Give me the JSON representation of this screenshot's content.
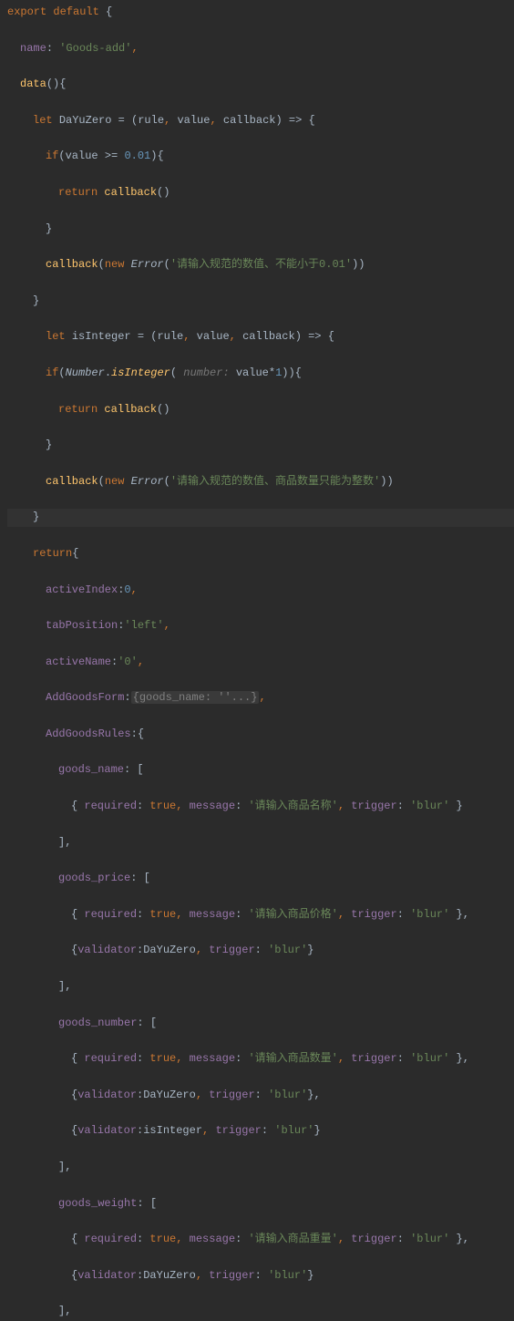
{
  "code": {
    "l1_export": "export",
    "l1_default": "default",
    "l1_brace": " {",
    "l2_name_key": "name",
    "l2_name_val": "'Goods-add'",
    "l3_data": "data",
    "l3_paren": "(){",
    "l4_let": "let",
    "l4_var": "DaYuZero",
    "l4_eq": " = (",
    "l4_rule": "rule",
    "l4_value": "value",
    "l4_callback": "callback",
    "l4_arrow": ") => {",
    "l5_if": "if",
    "l5_cond_open": "(",
    "l5_value": "value",
    "l5_gte": " >= ",
    "l5_num": "0.01",
    "l5_cond_close": "){",
    "l6_return": "return",
    "l6_callback": "callback",
    "l6_paren": "()",
    "l7_close": "}",
    "l8_callback": "callback",
    "l8_open": "(",
    "l8_new": "new",
    "l8_error": "Error",
    "l8_open2": "(",
    "l8_str": "'请输入规范的数值、不能小于0.01'",
    "l8_close": "))",
    "l9_close": "}",
    "l10_let": "let",
    "l10_var": "isInteger",
    "l10_eq": " = (",
    "l10_rule": "rule",
    "l10_value": "value",
    "l10_callback": "callback",
    "l10_arrow": ") => {",
    "l11_if": "if",
    "l11_open": "(",
    "l11_number": "Number",
    "l11_dot": ".",
    "l11_isint": "isInteger",
    "l11_open2": "(",
    "l11_hint": " number: ",
    "l11_value": "value",
    "l11_times": "*",
    "l11_one": "1",
    "l11_close": ")){",
    "l12_return": "return",
    "l12_callback": "callback",
    "l12_paren": "()",
    "l13_close": "}",
    "l14_callback": "callback",
    "l14_open": "(",
    "l14_new": "new",
    "l14_error": "Error",
    "l14_open2": "(",
    "l14_str": "'请输入规范的数值、商品数量只能为整数'",
    "l14_close": "))",
    "l15_close": "}",
    "l16_return": "return",
    "l16_brace": "{",
    "l17_key": "activeIndex",
    "l17_val": "0",
    "l18_key": "tabPosition",
    "l18_val": "'left'",
    "l19_key": "activeName",
    "l19_val": "'0'",
    "l20_key": "AddGoodsForm",
    "l20_folded": "{goods_name: ''...}",
    "l21_key": "AddGoodsRules",
    "l21_brace": ":{",
    "l22_key": "goods_name",
    "l22_open": ": [",
    "l23_open": "{ ",
    "l23_req": "required",
    "l23_true": "true",
    "l23_msg": "message",
    "l23_msgval": "'请输入商品名称'",
    "l23_trig": "trigger",
    "l23_trigval": "'blur'",
    "l23_close": " }",
    "l24_close": "],",
    "l25_key": "goods_price",
    "l25_open": ": [",
    "l26_open": "{ ",
    "l26_req": "required",
    "l26_true": "true",
    "l26_msg": "message",
    "l26_msgval": "'请输入商品价格'",
    "l26_trig": "trigger",
    "l26_trigval": "'blur'",
    "l26_close": " },",
    "l27_open": "{",
    "l27_val": "validator",
    "l27_dyz": "DaYuZero",
    "l27_trig": "trigger",
    "l27_trigval": "'blur'",
    "l27_close": "}",
    "l28_close": "],",
    "l29_key": "goods_number",
    "l29_open": ": [",
    "l30_open": "{ ",
    "l30_req": "required",
    "l30_true": "true",
    "l30_msg": "message",
    "l30_msgval": "'请输入商品数量'",
    "l30_trig": "trigger",
    "l30_trigval": "'blur'",
    "l30_close": " },",
    "l31_open": "{",
    "l31_val": "validator",
    "l31_dyz": "DaYuZero",
    "l31_trig": "trigger",
    "l31_trigval": "'blur'",
    "l31_close": "},",
    "l32_open": "{",
    "l32_val": "validator",
    "l32_isint": "isInteger",
    "l32_trig": "trigger",
    "l32_trigval": "'blur'",
    "l32_close": "}",
    "l33_close": "],",
    "l34_key": "goods_weight",
    "l34_open": ": [",
    "l35_open": "{ ",
    "l35_req": "required",
    "l35_true": "true",
    "l35_msg": "message",
    "l35_msgval": "'请输入商品重量'",
    "l35_trig": "trigger",
    "l35_trigval": "'blur'",
    "l35_close": " },",
    "l36_open": "{",
    "l36_val": "validator",
    "l36_dyz": "DaYuZero",
    "l36_trig": "trigger",
    "l36_trigval": "'blur'",
    "l36_close": "}",
    "l37_close": "],"
  }
}
